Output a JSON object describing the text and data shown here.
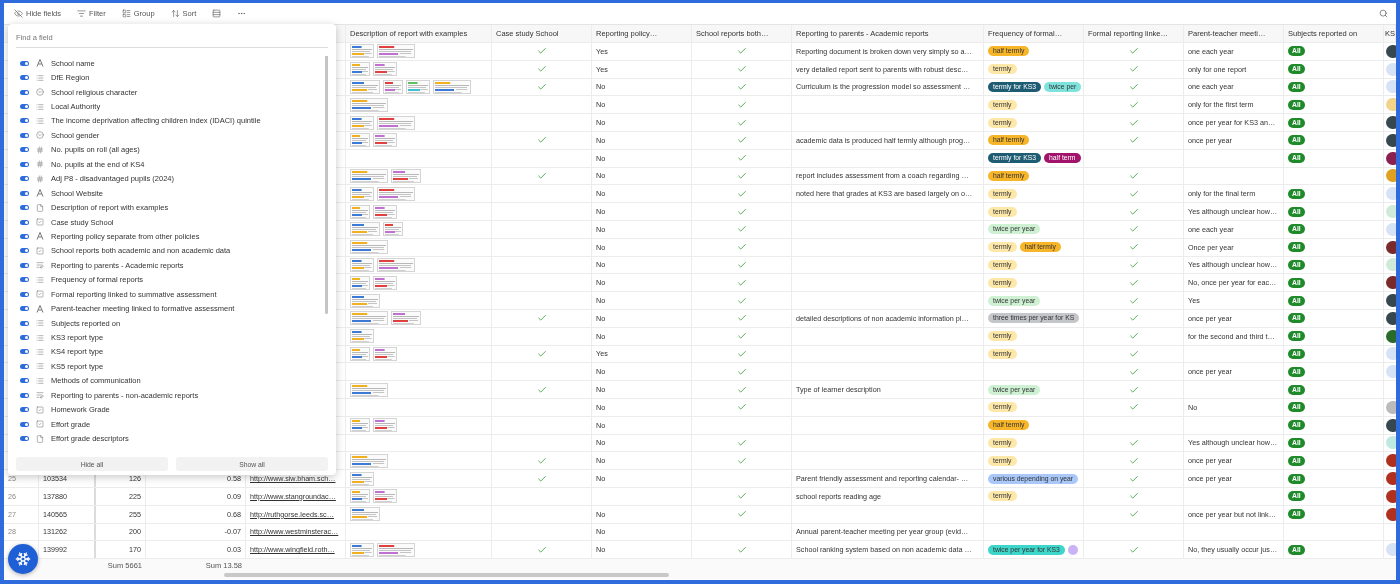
{
  "toolbar": {
    "buttons": [
      {
        "kind": "hide",
        "label": "Hide fields"
      },
      {
        "kind": "filter",
        "label": "Filter"
      },
      {
        "kind": "group",
        "label": "Group"
      },
      {
        "kind": "sort",
        "label": "Sort"
      },
      {
        "kind": "row_height"
      },
      {
        "kind": "more"
      }
    ]
  },
  "columns": [
    {
      "label": "Description of report with examples"
    },
    {
      "label": "Case study School"
    },
    {
      "label": "Reporting policy…"
    },
    {
      "label": "School reports both…"
    },
    {
      "label": "Reporting to parents - Academic reports"
    },
    {
      "label": "Frequency of formal…"
    },
    {
      "label": "Formal reporting linke…"
    },
    {
      "label": "Parent-teacher meeti…"
    },
    {
      "label": "Subjects reported on"
    },
    {
      "label": "KS"
    }
  ],
  "rows": [
    {
      "attachments": [
        {
          "kind": "picture"
        },
        {
          "kind": "picture"
        }
      ],
      "case_study_checked": true,
      "policy": "Yes",
      "both_checked": true,
      "academic": "Reporting document is broken down very simply so a…",
      "frequency": [
        {
          "label": "half termly",
          "color": "#f7b529"
        }
      ],
      "formal_checked": true,
      "meeting": "one each year",
      "subjects": [
        "All"
      ],
      "ks3": {
        "color": "#37474f"
      }
    },
    {
      "attachments": [
        {
          "kind": "picture"
        },
        {
          "kind": "picture"
        }
      ],
      "case_study_checked": true,
      "policy": "Yes",
      "both_checked": true,
      "academic": "very detailed report sent to parents with robust desc…",
      "frequency": [
        {
          "label": "termly",
          "color": "#fde7a9"
        }
      ],
      "formal_checked": true,
      "meeting": "only for one report",
      "subjects": [
        "All"
      ],
      "ks3": {
        "color": "#d6e2f5"
      }
    },
    {
      "attachments": [
        {
          "kind": "picture"
        },
        {
          "kind": "picture"
        },
        {
          "kind": "picture"
        },
        {
          "kind": "picture"
        }
      ],
      "case_study_checked": true,
      "policy": "No",
      "both_checked": true,
      "academic": "Curriculum is the progression model so assessment …",
      "frequency": [
        {
          "label": "termly for KS3",
          "color": "#1e5c73"
        },
        {
          "label": "twice per",
          "color": "#7ee3dc"
        }
      ],
      "formal_checked": true,
      "meeting": "one each year",
      "subjects": [
        "All"
      ],
      "ks3": {
        "color": "#d6e2f5"
      }
    },
    {
      "attachments": [
        {
          "kind": "picture"
        }
      ],
      "case_study_checked": false,
      "policy": "No",
      "both_checked": true,
      "frequency": [
        {
          "label": "termly",
          "color": "#fde7a9"
        }
      ],
      "formal_checked": true,
      "meeting": "only for the first term",
      "subjects": [
        "All"
      ],
      "ks3": {
        "color": "#f3d38a"
      }
    },
    {
      "attachments": [
        {
          "kind": "picture"
        },
        {
          "kind": "picture"
        }
      ],
      "case_study_checked": false,
      "policy": "No",
      "both_checked": true,
      "frequency": [
        {
          "label": "termly",
          "color": "#fde7a9"
        }
      ],
      "formal_checked": true,
      "meeting": "once per year for KS3 an…",
      "subjects": [
        "All"
      ],
      "ks3": {
        "color": "#37474f"
      }
    },
    {
      "attachments": [
        {
          "kind": "picture"
        },
        {
          "kind": "picture"
        }
      ],
      "case_study_checked": true,
      "policy": "No",
      "both_checked": true,
      "academic": "academic data is produced half termly although prog…",
      "frequency": [
        {
          "label": "half termly",
          "color": "#f7b529"
        }
      ],
      "formal_checked": true,
      "meeting": "once per year",
      "subjects": [
        "All"
      ],
      "ks3": {
        "color": "#37474f"
      }
    },
    {
      "attachments": [],
      "case_study_checked": false,
      "policy": "No",
      "both_checked": true,
      "frequency": [
        {
          "label": "termly for KS3",
          "color": "#1e5c73"
        },
        {
          "label": "half term",
          "color": "#a2146c"
        }
      ],
      "formal_checked": false,
      "subjects": [
        "All"
      ],
      "ks3": {
        "color": "#8a2050"
      }
    },
    {
      "attachments": [
        {
          "kind": "picture"
        },
        {
          "kind": "picture"
        }
      ],
      "case_study_checked": true,
      "policy": "No",
      "both_checked": true,
      "academic": "report includes assessment from a coach regarding …",
      "frequency": [
        {
          "label": "half termly",
          "color": "#f7b529"
        }
      ],
      "formal_checked": true,
      "subjects": [],
      "ks3": {
        "color": "#e0a020"
      }
    },
    {
      "attachments": [
        {
          "kind": "picture"
        },
        {
          "kind": "picture"
        }
      ],
      "case_study_checked": false,
      "policy": "No",
      "both_checked": true,
      "academic": "noted here that grades at KS3 are based largely on o…",
      "frequency": [
        {
          "label": "termly",
          "color": "#fde7a9"
        }
      ],
      "formal_checked": true,
      "meeting": "only for the final term",
      "subjects": [
        "All"
      ],
      "ks3": {
        "color": "#d6e2f5"
      }
    },
    {
      "attachments": [
        {
          "kind": "picture"
        },
        {
          "kind": "picture"
        }
      ],
      "case_study_checked": false,
      "policy": "No",
      "both_checked": true,
      "frequency": [
        {
          "label": "termly",
          "color": "#fde7a9"
        }
      ],
      "formal_checked": true,
      "meeting": "Yes although unclear how…",
      "subjects": [
        "All"
      ],
      "ks3": {
        "color": "#cfead8"
      }
    },
    {
      "attachments": [
        {
          "kind": "picture"
        },
        {
          "kind": "picture"
        }
      ],
      "case_study_checked": false,
      "policy": "No",
      "both_checked": true,
      "frequency": [
        {
          "label": "twice per year",
          "color": "#cdf1d2"
        }
      ],
      "formal_checked": true,
      "meeting": "one each year",
      "subjects": [
        "All"
      ],
      "ks3": {
        "color": "#d6e2f5"
      }
    },
    {
      "attachments": [
        {
          "kind": "picture"
        }
      ],
      "case_study_checked": false,
      "policy": "No",
      "both_checked": true,
      "frequency": [
        {
          "label": "termly",
          "color": "#fde7a9"
        },
        {
          "label": "half termly",
          "color": "#f7b529"
        }
      ],
      "formal_checked": true,
      "meeting": "Once per year",
      "subjects": [
        "All"
      ],
      "ks3": {
        "color": "#7a2a2a"
      }
    },
    {
      "attachments": [
        {
          "kind": "picture"
        },
        {
          "kind": "picture"
        }
      ],
      "case_study_checked": false,
      "policy": "No",
      "both_checked": true,
      "frequency": [
        {
          "label": "termly",
          "color": "#fde7a9"
        }
      ],
      "formal_checked": true,
      "meeting": "Yes although unclear how…",
      "subjects": [
        "All"
      ],
      "ks3": {
        "color": "#cfead8"
      }
    },
    {
      "attachments": [
        {
          "kind": "picture"
        },
        {
          "kind": "picture"
        }
      ],
      "case_study_checked": false,
      "policy": "No",
      "both_checked": true,
      "frequency": [
        {
          "label": "termly",
          "color": "#fde7a9"
        }
      ],
      "formal_checked": true,
      "meeting": "No, once per year for eac…",
      "subjects": [
        "All"
      ],
      "ks3": {
        "color": "#7a2a2a"
      }
    },
    {
      "attachments": [
        {
          "kind": "picture"
        }
      ],
      "case_study_checked": false,
      "policy": "No",
      "both_checked": true,
      "frequency": [
        {
          "label": "twice per year",
          "color": "#cdf1d2"
        }
      ],
      "formal_checked": true,
      "meeting": "Yes",
      "subjects": [
        "All"
      ],
      "ks3": {
        "color": "#37474f"
      }
    },
    {
      "attachments": [
        {
          "kind": "picture"
        },
        {
          "kind": "picture"
        }
      ],
      "case_study_checked": true,
      "policy": "No",
      "both_checked": true,
      "academic": "detailed descriptions of non academic information pl…",
      "frequency": [
        {
          "label": "three times per year for KS",
          "color": "#c5c6ca"
        }
      ],
      "formal_checked": true,
      "meeting": "once per year",
      "subjects": [
        "All"
      ],
      "ks3": {
        "color": "#37474f"
      }
    },
    {
      "attachments": [
        {
          "kind": "picture"
        }
      ],
      "case_study_checked": false,
      "policy": "No",
      "both_checked": true,
      "frequency": [
        {
          "label": "termly",
          "color": "#fde7a9"
        }
      ],
      "formal_checked": true,
      "meeting": "for the second and third t…",
      "subjects": [
        "All"
      ],
      "ks3": {
        "color": "#2a6a2a"
      }
    },
    {
      "attachments": [
        {
          "kind": "picture"
        },
        {
          "kind": "picture"
        }
      ],
      "case_study_checked": true,
      "policy": "Yes",
      "both_checked": true,
      "frequency": [
        {
          "label": "termly",
          "color": "#fde7a9"
        }
      ],
      "formal_checked": true,
      "subjects": [
        "All"
      ],
      "ks3": {
        "color": "#d6e2f5"
      }
    },
    {
      "attachments": [],
      "case_study_checked": false,
      "policy": "No",
      "both_checked": true,
      "frequency": [],
      "formal_checked": true,
      "meeting": "once per year",
      "subjects": [
        "All"
      ],
      "ks3": {
        "color": "#d6e2f5"
      }
    },
    {
      "attachments": [
        {
          "kind": "picture"
        }
      ],
      "case_study_checked": true,
      "policy": "No",
      "both_checked": true,
      "academic": "Type of learner description",
      "frequency": [
        {
          "label": "twice per year",
          "color": "#cdf1d2"
        }
      ],
      "formal_checked": true,
      "subjects": [
        "All"
      ]
    },
    {
      "attachments": [],
      "case_study_checked": false,
      "policy": "No",
      "both_checked": true,
      "frequency": [
        {
          "label": "termly",
          "color": "#fde7a9"
        }
      ],
      "formal_checked": true,
      "meeting": "No",
      "subjects": [
        "All"
      ],
      "ks3": {
        "color": "#bbbbbb"
      }
    },
    {
      "attachments": [
        {
          "kind": "picture"
        },
        {
          "kind": "picture"
        }
      ],
      "case_study_checked": false,
      "policy": "No",
      "both_checked": false,
      "frequency": [
        {
          "label": "half termly",
          "color": "#f7b529"
        }
      ],
      "formal_checked": false,
      "subjects": [
        "All"
      ],
      "ks3": {
        "color": "#37474f"
      }
    },
    {
      "attachments": [],
      "case_study_checked": false,
      "policy": "No",
      "both_checked": true,
      "frequency": [
        {
          "label": "termly",
          "color": "#fde7a9"
        }
      ],
      "formal_checked": true,
      "meeting": "Yes although unclear how…",
      "subjects": [
        "All"
      ],
      "ks3": {
        "color": "#bfe8e0"
      }
    },
    {
      "attachments": [
        {
          "kind": "picture"
        }
      ],
      "case_study_checked": true,
      "policy": "No",
      "both_checked": true,
      "frequency": [
        {
          "label": "termly",
          "color": "#fde7a9"
        }
      ],
      "formal_checked": true,
      "meeting": "once per year",
      "subjects": [
        "All"
      ],
      "ks3": {
        "color": "#b03020"
      }
    },
    {
      "number": "25",
      "urn": "103534",
      "pupils": "126",
      "p8": "0.58",
      "website": "http://www.siw.bham.sch…",
      "attachments": [
        {
          "kind": "picture"
        }
      ],
      "case_study_checked": true,
      "policy": "No",
      "both_checked": false,
      "academic": "Parent friendly assessment and reporting calendar- …",
      "frequency": [
        {
          "label": "various depending on year",
          "color": "#a9c7f9"
        }
      ],
      "formal_checked": true,
      "meeting": "once per year",
      "subjects": [
        "All"
      ],
      "ks3": {
        "color": "#b03020"
      }
    },
    {
      "number": "26",
      "urn": "137880",
      "pupils": "225",
      "p8": "0.09",
      "website": "http://www.stangroundac…",
      "attachments": [
        {
          "kind": "picture"
        },
        {
          "kind": "picture"
        }
      ],
      "case_study_checked": false,
      "both_checked": true,
      "academic": "school reports reading age",
      "frequency": [
        {
          "label": "termly",
          "color": "#fde7a9"
        }
      ],
      "formal_checked": true,
      "subjects": [
        "All"
      ],
      "ks3": {
        "color": "#b03020"
      }
    },
    {
      "number": "27",
      "urn": "140565",
      "pupils": "255",
      "p8": "0.68",
      "website": "http://ruthgorse.leeds.sc…",
      "attachments": [
        {
          "kind": "picture"
        }
      ],
      "case_study_checked": false,
      "policy": "No",
      "both_checked": true,
      "frequency": [],
      "formal_checked": true,
      "meeting": "once per year but not link…",
      "subjects": [
        "All"
      ],
      "ks3": {
        "color": "#b03020"
      }
    },
    {
      "number": "28",
      "urn": "131262",
      "pupils": "200",
      "p8": "-0.07",
      "website": "http://www.westminsterac…",
      "attachments": [],
      "case_study_checked": false,
      "policy": "No",
      "both_checked": false,
      "academic": "Annual parent-teacher meeting per year group (evid…",
      "frequency": [],
      "formal_checked": false,
      "subjects": []
    },
    {
      "urn": "139992",
      "pupils": "170",
      "p8": "0.03",
      "website": "http://www.wingfield.roth…",
      "attachments": [
        {
          "kind": "picture"
        },
        {
          "kind": "picture"
        }
      ],
      "case_study_checked": true,
      "policy": "No",
      "both_checked": true,
      "academic": "School ranking system based on non academic data …",
      "frequency": [
        {
          "label": "twice per year for KS3",
          "color": "#3dd6cb"
        },
        {
          "color": "#c9b3f6"
        }
      ],
      "formal_checked": true,
      "meeting": "No, they usually occur jus…",
      "subjects": [
        "All"
      ],
      "ks3": {
        "color": "#d6e2f5"
      }
    }
  ],
  "footer": {
    "pupils_sum": "Sum 5661",
    "p8_sum": "Sum 13.58"
  },
  "field_panel": {
    "search": {
      "placeholder": "Find a field"
    },
    "fields": [
      {
        "kind": "text",
        "label": "School name",
        "on": true
      },
      {
        "kind": "list",
        "label": "DfE Region",
        "on": true
      },
      {
        "kind": "option",
        "label": "School religious character",
        "on": true
      },
      {
        "kind": "list",
        "label": "Local Authority",
        "on": true
      },
      {
        "kind": "list",
        "label": "The income deprivation affecting children index (IDACI) quintile",
        "on": true
      },
      {
        "kind": "option",
        "label": "School gender",
        "on": true
      },
      {
        "kind": "number",
        "label": "No. pupils on roll (all ages)",
        "on": true
      },
      {
        "kind": "number",
        "label": "No. pupils at the end of KS4",
        "on": true
      },
      {
        "kind": "number",
        "label": "Adj P8 - disadvantaged pupils (2024)",
        "on": true
      },
      {
        "kind": "text",
        "label": "School Website",
        "on": true
      },
      {
        "kind": "file",
        "label": "Description of report with examples",
        "on": true
      },
      {
        "kind": "checkbox",
        "label": "Case study School",
        "on": true
      },
      {
        "kind": "text",
        "label": "Reporting policy separate from other policies",
        "on": true
      },
      {
        "kind": "checkbox",
        "label": "School reports both academic and non academic data",
        "on": true
      },
      {
        "kind": "richtext",
        "label": "Reporting to parents - Academic reports",
        "on": true
      },
      {
        "kind": "list",
        "label": "Frequency of formal reports",
        "on": true
      },
      {
        "kind": "checkbox",
        "label": "Formal reporting linked to summative assessment",
        "on": true
      },
      {
        "kind": "text",
        "label": "Parent-teacher meeting linked to formative assessment",
        "on": true
      },
      {
        "kind": "list",
        "label": "Subjects reported on",
        "on": true
      },
      {
        "kind": "list",
        "label": "KS3 report type",
        "on": true
      },
      {
        "kind": "list",
        "label": "KS4 report type",
        "on": true
      },
      {
        "kind": "list",
        "label": "KS5 report type",
        "on": true
      },
      {
        "kind": "list",
        "label": "Methods of communication",
        "on": true
      },
      {
        "kind": "richtext",
        "label": "Reporting to parents - non-academic reports",
        "on": true
      },
      {
        "kind": "checkbox",
        "label": "Homework Grade",
        "on": true
      },
      {
        "kind": "checkbox",
        "label": "Effort grade",
        "on": true
      },
      {
        "kind": "file",
        "label": "Effort grade descriptors",
        "on": true
      }
    ],
    "buttons": [
      "Hide all",
      "Show all"
    ]
  }
}
